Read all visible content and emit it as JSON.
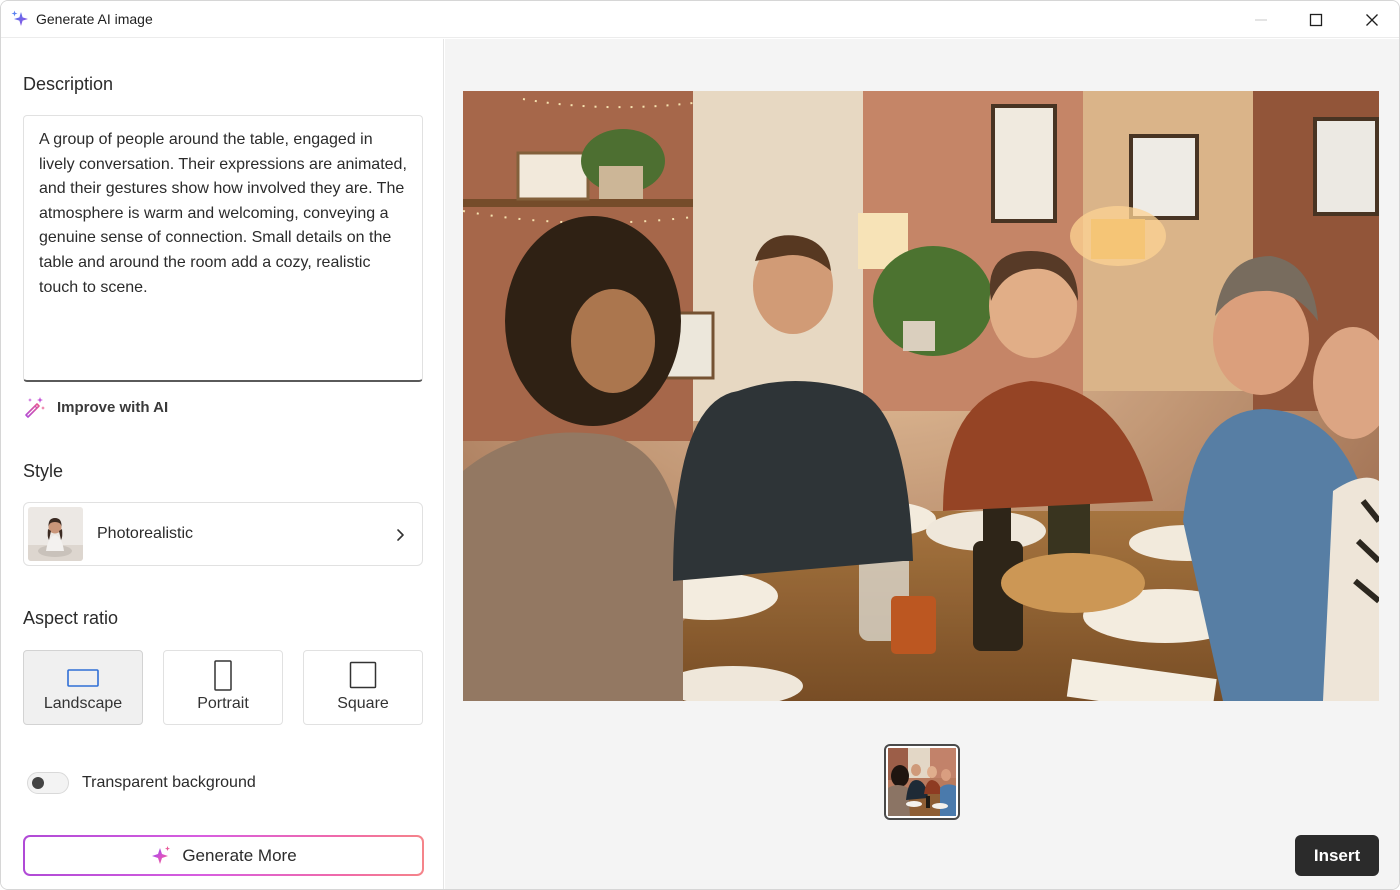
{
  "window": {
    "title": "Generate AI image",
    "controls": [
      "minimize-icon",
      "maximize-icon",
      "close-icon"
    ]
  },
  "left_panel": {
    "description": {
      "heading": "Description",
      "text": "A group of people around the table, engaged in lively conversation. Their expressions are animated, and their gestures show how involved they are. The atmosphere is warm and welcoming, conveying a genuine sense of connection. Small details on the table and around the room add a cozy, realistic touch to scene.",
      "improve_label": "Improve with AI"
    },
    "style": {
      "heading": "Style",
      "selected": "Photorealistic"
    },
    "aspect_ratio": {
      "heading": "Aspect ratio",
      "options": [
        {
          "label": "Landscape",
          "selected": true
        },
        {
          "label": "Portrait",
          "selected": false
        },
        {
          "label": "Square",
          "selected": false
        }
      ]
    },
    "transparent_background": {
      "label": "Transparent background",
      "enabled": false
    },
    "generate_button": "Generate More"
  },
  "right_panel": {
    "insert_button": "Insert"
  },
  "colors": {
    "accent_gradient_start": "#b04ad6",
    "accent_gradient_end": "#f5848a",
    "insert_button": "#2b2b2b",
    "panel_background": "#f4f4f4"
  }
}
